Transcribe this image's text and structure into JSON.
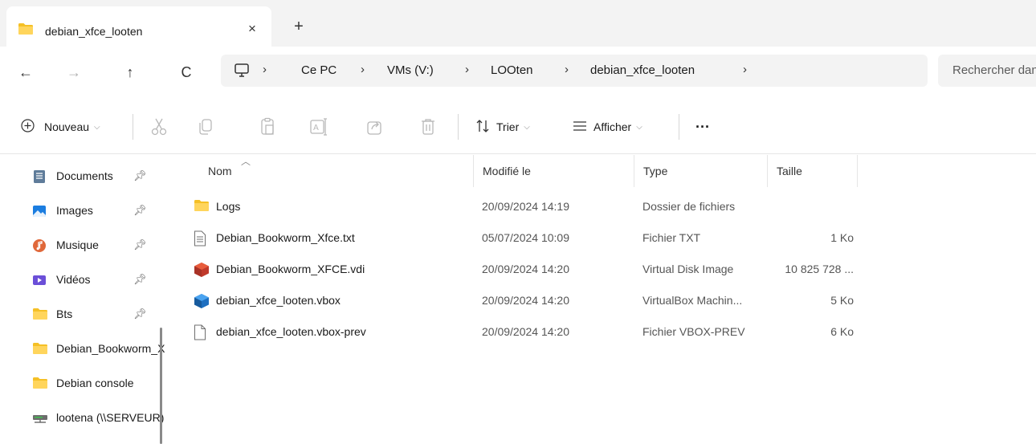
{
  "tab": {
    "title": "debian_xfce_looten",
    "close": "×",
    "new": "+"
  },
  "nav": {
    "back": "←",
    "forward": "→",
    "up": "↑",
    "refresh": "C"
  },
  "breadcrumb": [
    "Ce PC",
    "VMs (V:)",
    "LOOten",
    "debian_xfce_looten"
  ],
  "search": {
    "placeholder": "Rechercher dans : debian_xfce_looten"
  },
  "commandbar": {
    "new_label": "Nouveau",
    "sort_label": "Trier",
    "view_label": "Afficher",
    "more": "···"
  },
  "sidebar": {
    "items": [
      {
        "label": "Documents",
        "icon": "documents-icon",
        "pinned": true
      },
      {
        "label": "Images",
        "icon": "images-icon",
        "pinned": true
      },
      {
        "label": "Musique",
        "icon": "music-icon",
        "pinned": true
      },
      {
        "label": "Vidéos",
        "icon": "videos-icon",
        "pinned": true
      },
      {
        "label": "Bts",
        "icon": "folder-icon",
        "pinned": true
      },
      {
        "label": "Debian_Bookworm_XFCE",
        "icon": "folder-icon",
        "pinned": false
      },
      {
        "label": "Debian console",
        "icon": "folder-icon",
        "pinned": false
      },
      {
        "label": "lootena (\\\\SERVEUR)",
        "icon": "network-drive-icon",
        "pinned": false
      }
    ]
  },
  "columns": {
    "name": "Nom",
    "modified": "Modifié le",
    "type": "Type",
    "size": "Taille"
  },
  "files": [
    {
      "name": "Logs",
      "modified": "20/09/2024 14:19",
      "type": "Dossier de fichiers",
      "size": "",
      "icon": "folder-icon"
    },
    {
      "name": "Debian_Bookworm_Xfce.txt",
      "modified": "05/07/2024 10:09",
      "type": "Fichier TXT",
      "size": "1 Ko",
      "icon": "text-file-icon"
    },
    {
      "name": "Debian_Bookworm_XFCE.vdi",
      "modified": "20/09/2024 14:20",
      "type": "Virtual Disk Image",
      "size": "10 825 728 ...",
      "icon": "vdi-icon"
    },
    {
      "name": "debian_xfce_looten.vbox",
      "modified": "20/09/2024 14:20",
      "type": "VirtualBox Machin...",
      "size": "5 Ko",
      "icon": "vbox-icon"
    },
    {
      "name": "debian_xfce_looten.vbox-prev",
      "modified": "20/09/2024 14:20",
      "type": "Fichier VBOX-PREV",
      "size": "6 Ko",
      "icon": "blank-file-icon"
    }
  ],
  "colors": {
    "folder": "#f5c026",
    "accent": "#0067c0",
    "chrome": "#f3f3f3"
  }
}
